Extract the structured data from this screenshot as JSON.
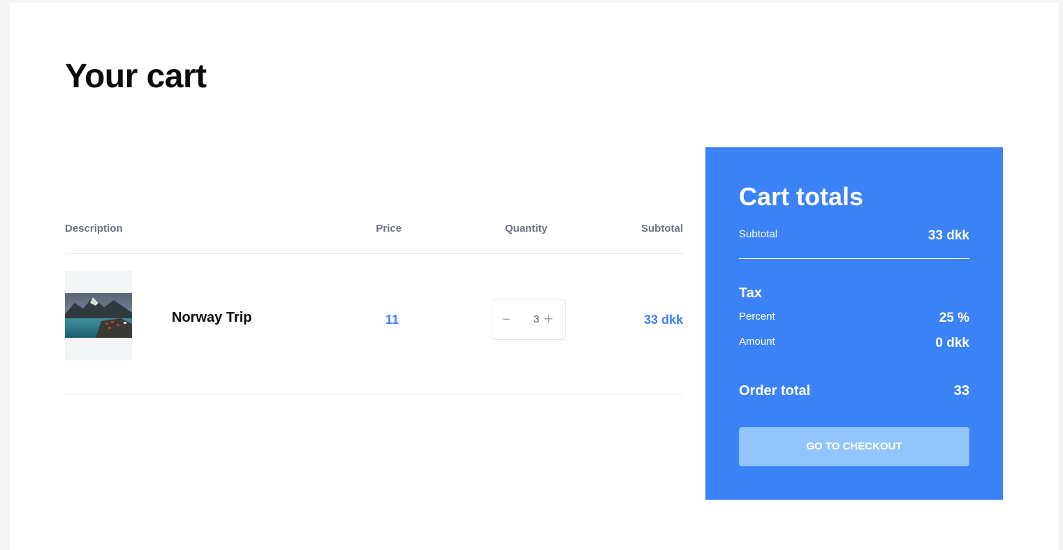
{
  "page": {
    "title": "Your cart"
  },
  "table": {
    "headers": {
      "description": "Description",
      "price": "Price",
      "quantity": "Quantity",
      "subtotal": "Subtotal"
    },
    "rows": [
      {
        "image_icon": "landscape-photo",
        "name": "Norway Trip",
        "price": "11",
        "quantity": "3",
        "subtotal": "33 dkk"
      }
    ],
    "controls": {
      "minus": "−",
      "plus": "+"
    }
  },
  "totals": {
    "title": "Cart totals",
    "subtotal_label": "Subtotal",
    "subtotal_value": "33 dkk",
    "tax_heading": "Tax",
    "percent_label": "Percent",
    "percent_value": "25 %",
    "amount_label": "Amount",
    "amount_value": "0 dkk",
    "order_total_label": "Order total",
    "order_total_value": "33",
    "checkout_label": "GO TO CHECKOUT"
  },
  "colors": {
    "accent": "#3b82f6",
    "checkout_button": "#93c5fd",
    "background": "#f3f4f6"
  }
}
